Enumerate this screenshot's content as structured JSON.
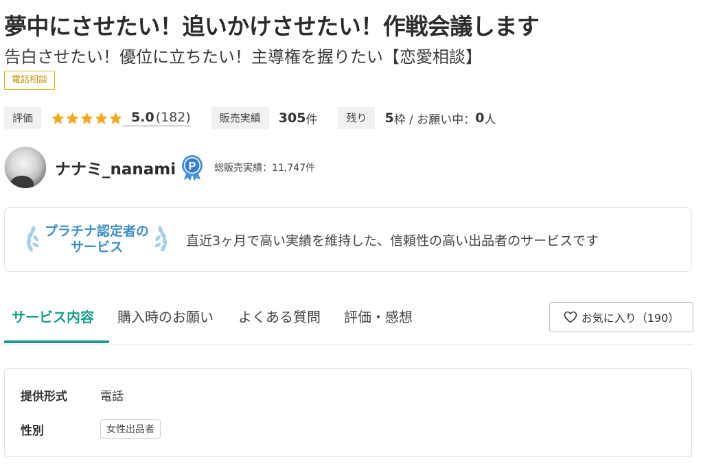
{
  "service": {
    "title": "夢中にさせたい！追いかけさせたい！作戦会議します",
    "subtitle": "告白させたい！優位に立ちたい！主導権を握りたい【恋愛相談】",
    "category_tag": "電話相談"
  },
  "stats": {
    "rating_label": "評価",
    "rating_value": "5.0",
    "rating_count": "(182)",
    "star_count": 5,
    "sales_label": "販売実績",
    "sales_value": "305",
    "sales_unit": "件",
    "remaining_label": "残り",
    "remaining_value": "5",
    "remaining_text": "枠 / お願い中：",
    "requesting_value": "0",
    "requesting_unit": "人"
  },
  "seller": {
    "name": "ナナミ_nanami",
    "badge_letter": "P",
    "total_sales": "総販売実績：11,747件"
  },
  "platinum": {
    "title_line1": "プラチナ認定者の",
    "title_line2": "サービス",
    "description": "直近3ヶ月で高い実績を維持した、信頼性の高い出品者のサービスです"
  },
  "tabs": [
    {
      "label": "サービス内容",
      "active": true
    },
    {
      "label": "購入時のお願い",
      "active": false
    },
    {
      "label": "よくある質問",
      "active": false
    },
    {
      "label": "評価・感想",
      "active": false
    }
  ],
  "favorite": {
    "label": "お気に入り（190）"
  },
  "details": {
    "format_label": "提供形式",
    "format_value": "電話",
    "gender_label": "性別",
    "gender_value": "女性出品者"
  },
  "colors": {
    "accent": "#1a9b8a",
    "star": "#f5a623",
    "platinum": "#3a8ec8",
    "category_border": "#e6b422"
  },
  "icons": {
    "star": "star-icon",
    "badge": "platinum-p-badge-icon",
    "laurel": "laurel-icon",
    "heart": "heart-icon"
  }
}
